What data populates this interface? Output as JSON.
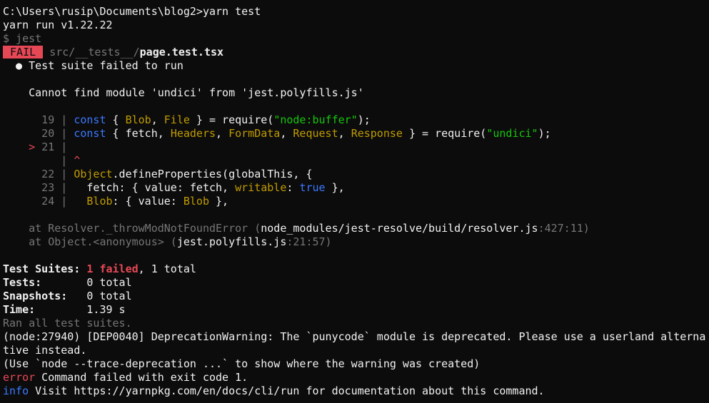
{
  "terminal": {
    "prompt": "C:\\Users\\rusip\\Documents\\blog2>",
    "command": "yarn test",
    "yarn_version": "yarn run v1.22.22",
    "jest_cmd": "$ jest",
    "fail_badge": " FAIL ",
    "test_path_dir": " src/__tests__/",
    "test_file": "page.test.tsx",
    "bullet": "  ● ",
    "suite_failed": "Test suite failed to run",
    "error_message": "    Cannot find module 'undici' from 'jest.polyfills.js'",
    "code": {
      "l19": {
        "gutter": "      19 | ",
        "kw": "const",
        "p1": " { ",
        "id1": "Blob",
        "p2": ", ",
        "id2": "File",
        "p3": " } = require(",
        "str": "\"node:buffer\"",
        "p4": ");"
      },
      "l20": {
        "gutter": "      20 | ",
        "kw": "const",
        "p1": " { fetch, ",
        "id1": "Headers",
        "p2": ", ",
        "id2": "FormData",
        "p3": ", ",
        "id3": "Request",
        "p4": ", ",
        "id4": "Response",
        "p5": " } = require(",
        "str": "\"undici\"",
        "p6": ");"
      },
      "l21": {
        "marker": "    > ",
        "gutter": "21 |"
      },
      "caret": {
        "gutter": "         | ",
        "char": "^"
      },
      "l22": {
        "gutter": "      22 | ",
        "obj": "Object",
        "rest": ".defineProperties(globalThis, {"
      },
      "l23": {
        "gutter": "      23 | ",
        "p1": "  fetch: { value: fetch, ",
        "key": "writable",
        "p2": ": ",
        "val": "true",
        "p3": " },"
      },
      "l24": {
        "gutter": "      24 | ",
        "p1": "  ",
        "key": "Blob",
        "p2": ": { value: ",
        "val": "Blob",
        "p3": " },"
      }
    },
    "stack": [
      {
        "at": "    at Resolver._throwModNotFoundError (",
        "file": "node_modules/jest-resolve/build/resolver.js",
        "loc": ":427:11)"
      },
      {
        "at": "    at Object.<anonymous> (",
        "file": "jest.polyfills.js",
        "loc": ":21:57)"
      }
    ],
    "summary": {
      "suites_label": "Test Suites: ",
      "suites_failed": "1 failed",
      "suites_rest": ", 1 total",
      "tests_label": "Tests:       ",
      "tests_value": "0 total",
      "snapshots_label": "Snapshots:   ",
      "snapshots_value": "0 total",
      "time_label": "Time:        ",
      "time_value": "1.39 s",
      "ran_all": "Ran all test suites."
    },
    "deprecation_1": "(node:27940) [DEP0040] DeprecationWarning: The `punycode` module is deprecated. Please use a userland alterna",
    "deprecation_2": "tive instead.",
    "deprecation_3": "(Use `node --trace-deprecation ...` to show where the warning was created)",
    "error_label": "error",
    "error_text": " Command failed with exit code 1.",
    "info_label": "info",
    "info_text_pre": " Visit ",
    "info_url": "https://yarnpkg.com/en/docs/cli/run",
    "info_text_post": " for documentation about this command."
  }
}
